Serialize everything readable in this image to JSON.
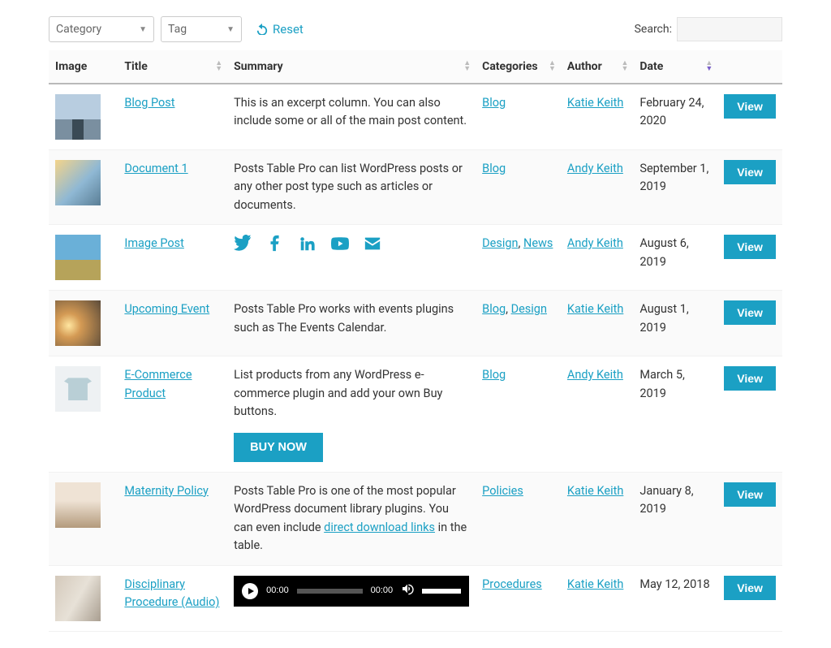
{
  "filters": {
    "category_label": "Category",
    "tag_label": "Tag",
    "reset_label": "Reset",
    "search_label": "Search:",
    "search_value": ""
  },
  "columns": {
    "image": "Image",
    "title": "Title",
    "summary": "Summary",
    "categories": "Categories",
    "author": "Author",
    "date": "Date"
  },
  "view_label": "View",
  "buy_now_label": "BUY NOW",
  "audio": {
    "current": "00:00",
    "total": "00:00"
  },
  "rows": [
    {
      "thumb_class": "t-pier",
      "title": "Blog Post",
      "summary_type": "text",
      "summary": "This is an excerpt column. You can also include some or all of the main post content.",
      "categories": [
        "Blog"
      ],
      "author": "Katie Keith",
      "date": "February 24, 2020"
    },
    {
      "thumb_class": "t-road",
      "title": "Document 1",
      "summary_type": "text",
      "summary": "Posts Table Pro can list WordPress posts or any other post type such as articles or documents.",
      "categories": [
        "Blog"
      ],
      "author": "Andy Keith",
      "date": "September 1, 2019"
    },
    {
      "thumb_class": "t-field",
      "title": "Image Post",
      "summary_type": "social",
      "social": [
        "twitter-icon",
        "facebook-icon",
        "linkedin-icon",
        "youtube-icon",
        "envelope-icon"
      ],
      "categories": [
        "Design",
        "News"
      ],
      "author": "Andy Keith",
      "date": "August 6, 2019"
    },
    {
      "thumb_class": "t-sun",
      "title": "Upcoming Event",
      "summary_type": "text",
      "summary": "Posts Table Pro works with events plugins such as The Events Calendar.",
      "categories": [
        "Blog",
        "Design"
      ],
      "author": "Katie Keith",
      "date": "August 1, 2019"
    },
    {
      "thumb_class": "t-shirt",
      "title": "E-Commerce Product",
      "summary_type": "buy",
      "summary": "List products from any WordPress e-commerce plugin and add your own Buy buttons.",
      "categories": [
        "Blog"
      ],
      "author": "Andy Keith",
      "date": "March 5, 2019"
    },
    {
      "thumb_class": "t-hands",
      "title": "Maternity Policy",
      "summary_type": "richtext",
      "summary_pre": "Posts Table Pro is one of the most popular WordPress document library plugins. You can even include ",
      "summary_link": "direct download links",
      "summary_post": " in the table.",
      "categories": [
        "Policies"
      ],
      "author": "Katie Keith",
      "date": "January 8, 2019"
    },
    {
      "thumb_class": "t-desk",
      "title": "Disciplinary Procedure (Audio)",
      "summary_type": "audio",
      "categories": [
        "Procedures"
      ],
      "author": "Katie Keith",
      "date": "May 12, 2018"
    }
  ]
}
